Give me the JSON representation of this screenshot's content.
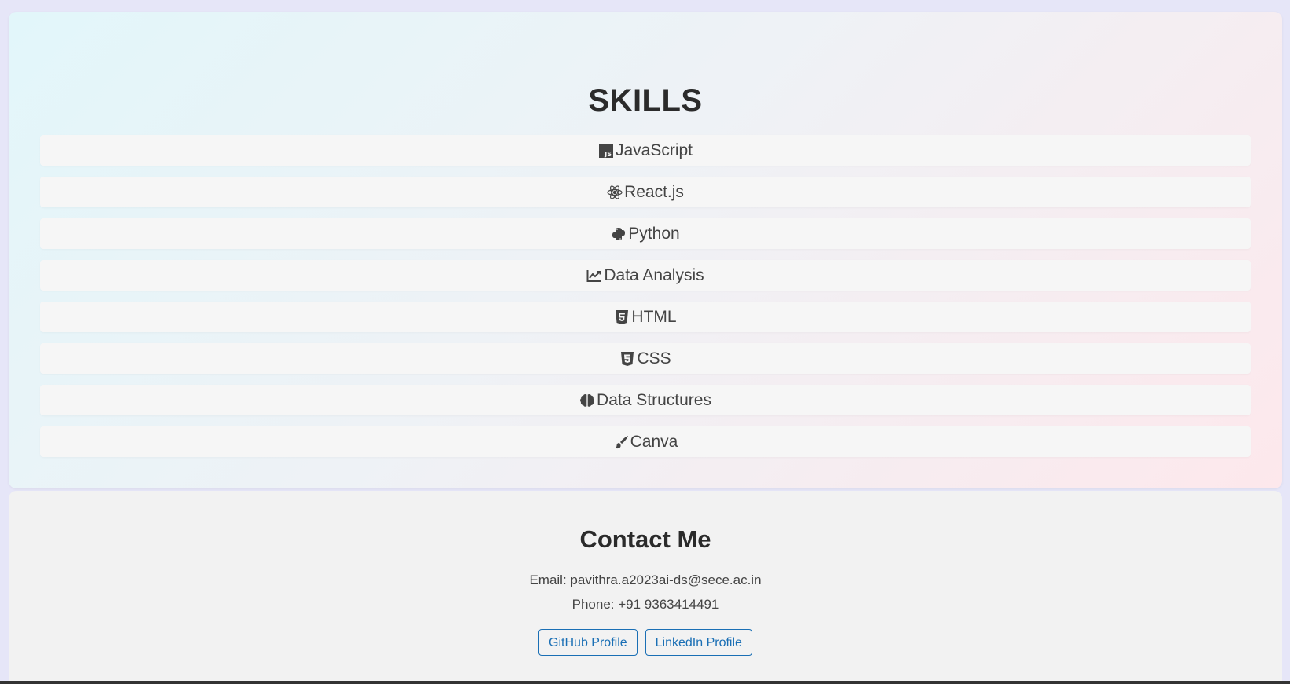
{
  "skills": {
    "title": "SKILLS",
    "items": [
      {
        "label": "JavaScript",
        "icon": "js-icon"
      },
      {
        "label": "React.js",
        "icon": "react-icon"
      },
      {
        "label": "Python",
        "icon": "python-icon"
      },
      {
        "label": "Data Analysis",
        "icon": "chart-line-icon"
      },
      {
        "label": "HTML",
        "icon": "html5-icon"
      },
      {
        "label": "CSS",
        "icon": "css3-icon"
      },
      {
        "label": "Data Structures",
        "icon": "brain-icon"
      },
      {
        "label": "Canva",
        "icon": "paintbrush-icon"
      }
    ]
  },
  "contact": {
    "title": "Contact Me",
    "email": "Email: pavithra.a2023ai-ds@sece.ac.in",
    "phone": "Phone: +91 9363414491",
    "github_label": "GitHub Profile",
    "linkedin_label": "LinkedIn Profile"
  },
  "colors": {
    "link": "#1a6fb5",
    "heading": "#2b2b2b",
    "text": "#444444"
  }
}
